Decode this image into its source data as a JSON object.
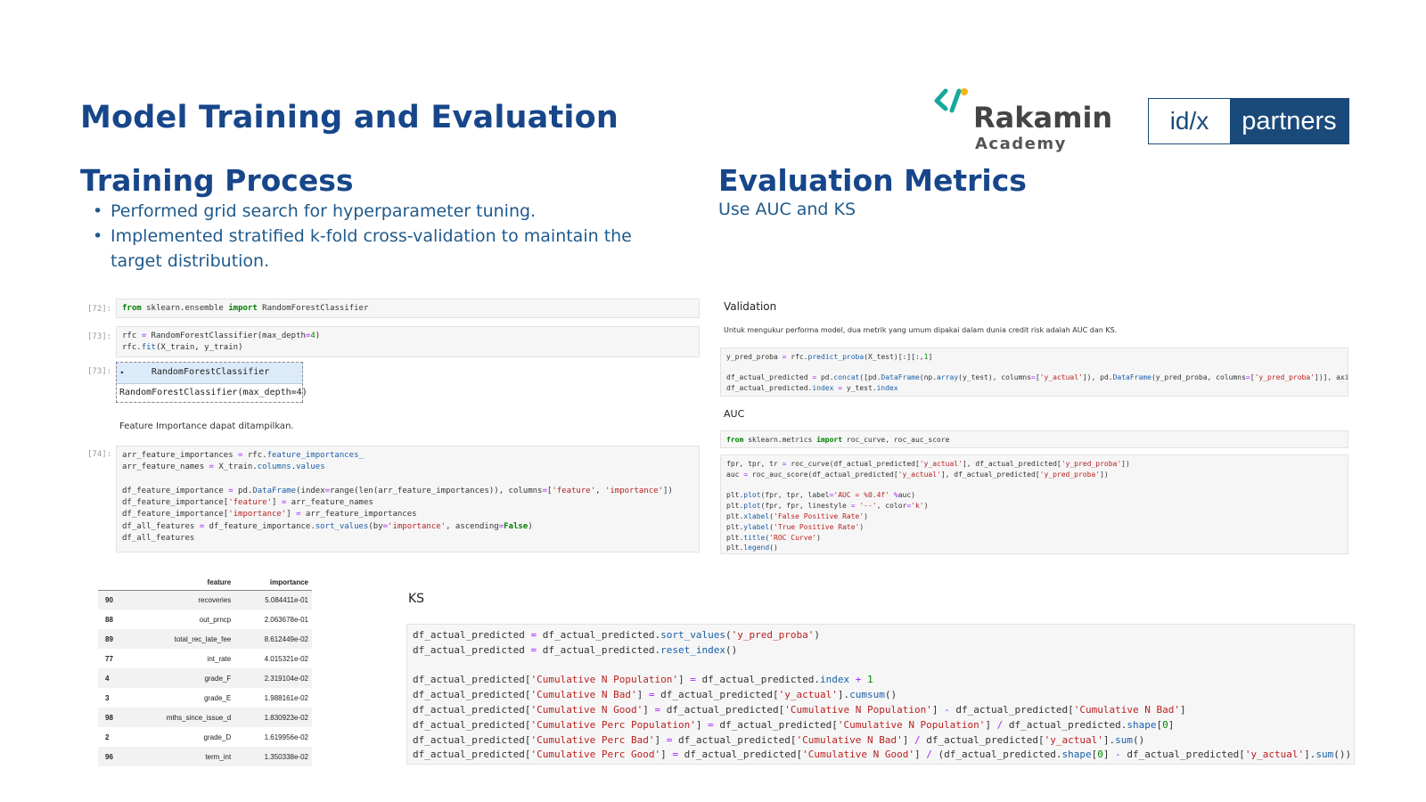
{
  "title": "Model Training and Evaluation",
  "training": {
    "heading": "Training Process",
    "bullets": [
      "Performed grid search for hyperparameter tuning.",
      "Implemented stratified k-fold cross-validation to maintain the target distribution."
    ]
  },
  "evaluation": {
    "heading": "Evaluation Metrics",
    "subtitle": "Use AUC and KS"
  },
  "logos": {
    "rakamin_name": "Rakamin",
    "rakamin_sub": "Academy",
    "idx_left": "id/x",
    "idx_right": "partners"
  },
  "colors": {
    "heading": "#17468a",
    "text": "#1f5a8c",
    "partners_bg": "#1a4a7a"
  },
  "notebook_left": {
    "cell72_num": "[72]:",
    "cell73_num": "[73]:",
    "cell73_out_num": "[73]:",
    "cell74_num": "[74]:",
    "rf_output_title": "RandomForestClassifier",
    "rf_output_body": "RandomForestClassifier(max_depth=4)",
    "feature_note": "Feature Importance dapat ditampilkan."
  },
  "notebook_right": {
    "validation_label": "Validation",
    "validation_text": "Untuk mengukur performa model, dua metrik yang umum dipakai dalam dunia credit risk adalah AUC dan KS.",
    "auc_label": "AUC",
    "ks_label": "KS"
  },
  "feature_table": {
    "columns": [
      "",
      "feature",
      "importance"
    ],
    "rows": [
      [
        "90",
        "recoveries",
        "5.084411e-01"
      ],
      [
        "88",
        "out_prncp",
        "2.063678e-01"
      ],
      [
        "89",
        "total_rec_late_fee",
        "8.612449e-02"
      ],
      [
        "77",
        "int_rate",
        "4.015321e-02"
      ],
      [
        "4",
        "grade_F",
        "2.319104e-02"
      ],
      [
        "3",
        "grade_E",
        "1.988161e-02"
      ],
      [
        "98",
        "mths_since_issue_d",
        "1.830923e-02"
      ],
      [
        "2",
        "grade_D",
        "1.619956e-02"
      ],
      [
        "96",
        "term_int",
        "1.350338e-02"
      ]
    ]
  }
}
